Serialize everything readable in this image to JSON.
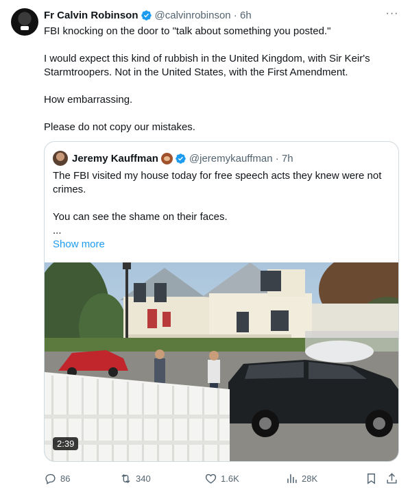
{
  "author": {
    "name": "Fr Calvin Robinson",
    "handle": "@calvinrobinson",
    "time": "6h"
  },
  "more_label": "···",
  "tweet_lines": [
    "FBI knocking on the door to \"talk about something you posted.\"",
    "",
    "I would expect this kind of rubbish in the United Kingdom, with Sir Keir's Starmtroopers. Not in the United States, with the First Amendment.",
    "",
    "How embarrassing.",
    "",
    "Please do not copy our mistakes."
  ],
  "quote": {
    "name": "Jeremy Kauffman",
    "handle": "@jeremykauffman",
    "time": "7h",
    "lines": [
      "The FBI visited my house today for free speech acts they knew were not crimes.",
      "",
      "You can see the shame on their faces.",
      "..."
    ],
    "show_more": "Show more",
    "video_duration": "2:39"
  },
  "actions": {
    "replies": "86",
    "reposts": "340",
    "likes": "1.6K",
    "views": "28K"
  },
  "colors": {
    "accent": "#1d9bf0",
    "text": "#0f1419",
    "muted": "#536471",
    "border": "#cfd9de"
  }
}
